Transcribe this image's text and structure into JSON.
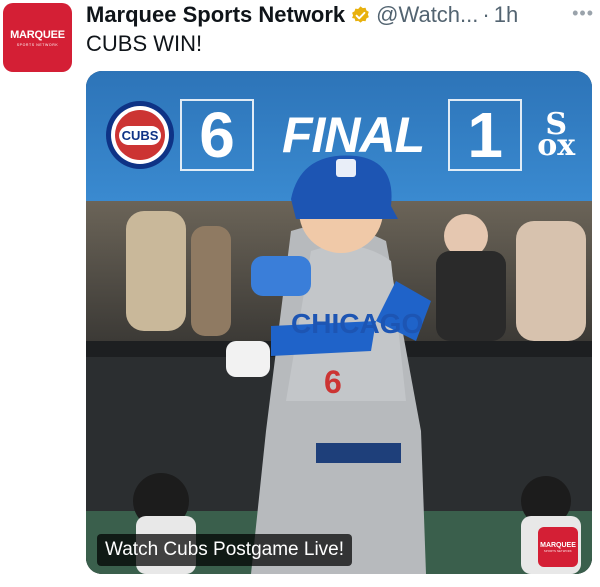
{
  "account": {
    "avatar_text": "MARQUEE",
    "avatar_subtext": "SPORTS NETWORK",
    "display_name": "Marquee Sports Network",
    "handle": "@Watch...",
    "separator": "·",
    "timestamp": "1h",
    "more_label": "•••"
  },
  "tweet": {
    "text": "CUBS WIN!"
  },
  "media": {
    "home_logo_text": "CUBS",
    "home_score": "6",
    "status": "FINAL",
    "away_score": "1",
    "away_logo_text": "S\nox",
    "jersey_text": "CHICAGO",
    "jersey_number": "6",
    "caption": "Watch Cubs Postgame Live!",
    "badge_text": "MARQUEE",
    "badge_subtext": "SPORTS NETWORK"
  },
  "colors": {
    "brand_red": "#d41f35",
    "verified_gold": "#e8b10e",
    "cubs_blue": "#0e3386",
    "cubs_red": "#cc3433"
  },
  "icons": [
    "verified-badge-icon",
    "more-options-icon",
    "cubs-logo-icon",
    "white-sox-logo-icon"
  ]
}
